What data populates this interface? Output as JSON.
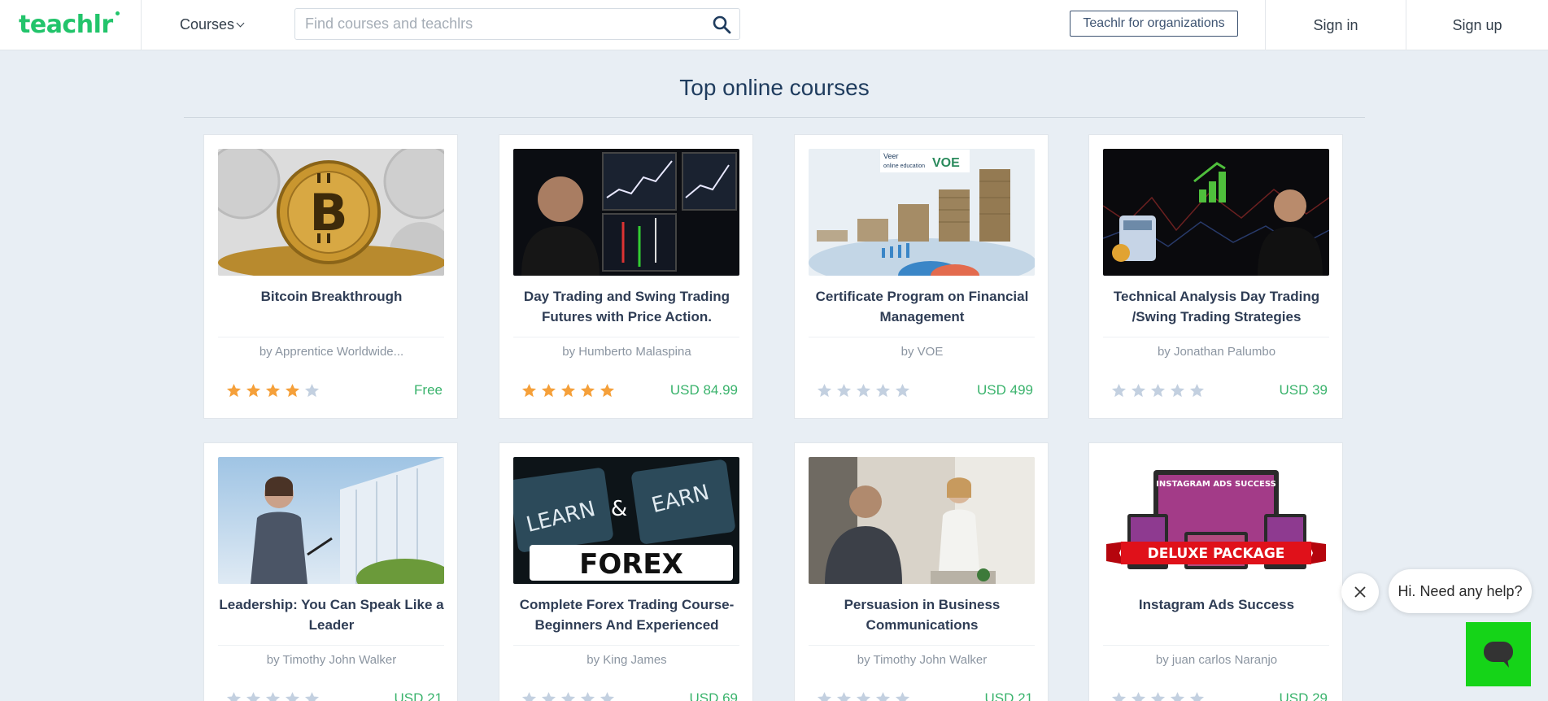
{
  "header": {
    "logo": "teachlr",
    "courses_menu": "Courses",
    "search_placeholder": "Find courses and teachlrs",
    "org_button": "Teachlr for organizations",
    "sign_in": "Sign in",
    "sign_up": "Sign up"
  },
  "section": {
    "title": "Top online courses"
  },
  "courses": [
    {
      "title": "Bitcoin Breakthrough",
      "author": "by Apprentice Worldwide...",
      "price": "Free",
      "rating": 4
    },
    {
      "title": "Day Trading and Swing Trading Futures with Price Action.",
      "author": "by Humberto Malaspina",
      "price": "USD 84.99",
      "rating": 5
    },
    {
      "title": "Certificate Program on Financial Management",
      "author": "by VOE",
      "price": "USD 499",
      "rating": 0
    },
    {
      "title": "Technical Analysis Day Trading /Swing Trading Strategies",
      "author": "by Jonathan Palumbo",
      "price": "USD 39",
      "rating": 0
    },
    {
      "title": "Leadership: You Can Speak Like a Leader",
      "author": "by Timothy John Walker",
      "price": "USD 21",
      "rating": 0
    },
    {
      "title": "Complete Forex Trading Course-Beginners And Experienced",
      "author": "by King James",
      "price": "USD 69",
      "rating": 0
    },
    {
      "title": "Persuasion in Business Communications",
      "author": "by Timothy John Walker",
      "price": "USD 21",
      "rating": 0
    },
    {
      "title": "Instagram Ads Success",
      "author": "by juan carlos Naranjo",
      "price": "USD 29",
      "rating": 0
    }
  ],
  "thumb_text": {
    "voe_logo_line1": "Veer",
    "voe_logo_line2": "online education",
    "voe_logo_mark": "VOE",
    "forex_key1": "LEARN",
    "forex_amp": "&",
    "forex_key2": "EARN",
    "forex_word": "FOREX",
    "insta_banner": "DELUXE PACKAGE",
    "insta_screen": "INSTAGRAM ADS SUCCESS"
  },
  "chat": {
    "message": "Hi. Need any help?"
  },
  "colors": {
    "brand": "#22c46b",
    "price": "#3ab36c",
    "star_filled": "#f5a03a",
    "star_empty": "#c3d0e0",
    "chat_button": "#15d418"
  }
}
